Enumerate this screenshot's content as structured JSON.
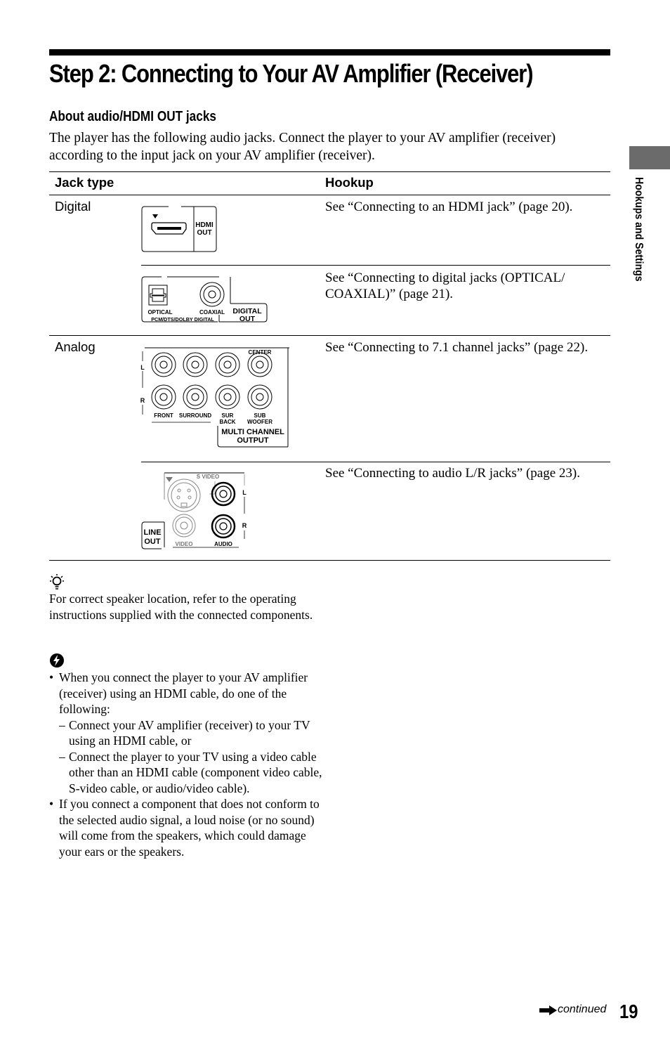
{
  "header": {
    "title": "Step 2: Connecting to Your AV Amplifier (Receiver)",
    "section_heading": "About audio/HDMI OUT jacks",
    "intro": "The player has the following audio jacks. Connect the player to your AV amplifier (receiver) according to the input jack on your AV amplifier (receiver)."
  },
  "table": {
    "columns": [
      "Jack type",
      "Hookup"
    ],
    "rows": [
      {
        "category": "Digital",
        "diagram": "hdmi-out-jack",
        "diagram_labels": {
          "panel": "HDMI OUT",
          "line1": "HDMI",
          "line2": "OUT"
        },
        "hookup": "See “Connecting to an HDMI jack” (page 20)."
      },
      {
        "category": "",
        "diagram": "digital-out-jacks",
        "diagram_labels": {
          "optical": "OPTICAL",
          "coaxial": "COAXIAL",
          "formats": "PCM/DTS/DOLBY DIGITAL",
          "line1": "DIGITAL",
          "line2": "OUT"
        },
        "hookup": "See “Connecting to digital jacks (OPTICAL/ COAXIAL)” (page 21)."
      },
      {
        "category": "Analog",
        "diagram": "multi-channel-output-jacks",
        "diagram_labels": {
          "left": "L",
          "right": "R",
          "front": "FRONT",
          "surround": "SURROUND",
          "sur": "SUR",
          "back": "BACK",
          "center": "CENTER",
          "sub": "SUB",
          "woofer": "WOOFER",
          "line1": "MULTI CHANNEL",
          "line2": "OUTPUT"
        },
        "hookup": "See “Connecting to 7.1 channel jacks” (page 22)."
      },
      {
        "category": "",
        "diagram": "line-out-jacks",
        "diagram_labels": {
          "svideo": "S VIDEO",
          "video": "VIDEO",
          "audio": "AUDIO",
          "left": "L",
          "right": "R",
          "line1": "LINE",
          "line2": "OUT"
        },
        "hookup": "See “Connecting to audio L/R jacks” (page 23)."
      }
    ]
  },
  "tip": {
    "icon": "lightbulb-icon",
    "text": "For correct speaker location, refer to the operating instructions supplied with the connected components."
  },
  "notes": {
    "icon": "caution-icon",
    "bullets": [
      {
        "text": "When you connect the player to your AV amplifier (receiver) using an HDMI cable, do one of the following:",
        "sub": [
          "Connect your AV amplifier (receiver) to your TV using an HDMI cable, or",
          "Connect the player to your TV using a video cable other than an HDMI cable (component video cable, S-video cable, or audio/video cable)."
        ]
      },
      {
        "text": "If you connect a component that does not conform to the selected audio signal, a loud noise (or no sound) will come from the speakers, which could damage your ears or the speakers.",
        "sub": []
      }
    ],
    "bullet_glyph": "•",
    "dash_glyph": "–"
  },
  "side_tab": {
    "label": "Hookups and Settings",
    "color": "#6b6b6b"
  },
  "footer": {
    "continued": "continued",
    "page_number": "19"
  }
}
